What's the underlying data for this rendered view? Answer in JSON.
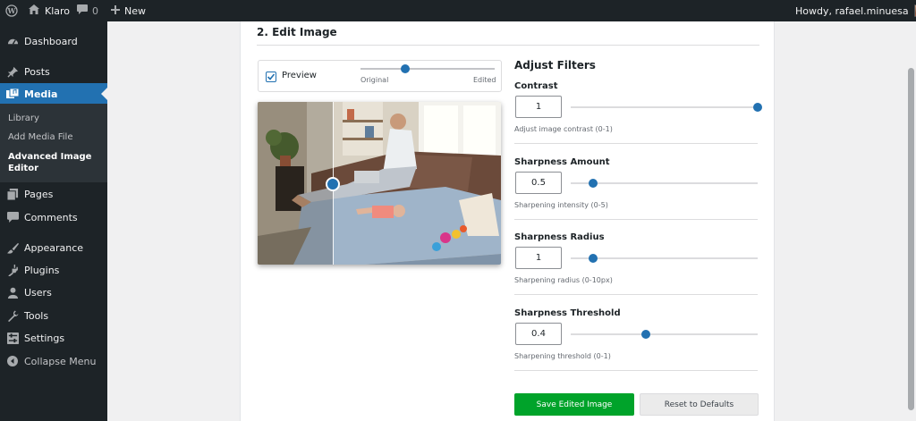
{
  "admin_bar": {
    "site_name": "Klaro",
    "comments_count": "0",
    "new_label": "New",
    "greeting": "Howdy, rafael.minuesa"
  },
  "sidebar": {
    "items": [
      {
        "label": "Dashboard",
        "icon": "dashboard-icon"
      },
      {
        "label": "Posts",
        "icon": "pin-icon"
      },
      {
        "label": "Media",
        "icon": "media-icon",
        "active": true
      },
      {
        "label": "Pages",
        "icon": "pages-icon"
      },
      {
        "label": "Comments",
        "icon": "comment-icon"
      },
      {
        "label": "Appearance",
        "icon": "brush-icon"
      },
      {
        "label": "Plugins",
        "icon": "plug-icon"
      },
      {
        "label": "Users",
        "icon": "user-icon"
      },
      {
        "label": "Tools",
        "icon": "wrench-icon"
      },
      {
        "label": "Settings",
        "icon": "settings-icon"
      },
      {
        "label": "Collapse Menu",
        "icon": "collapse-icon"
      }
    ],
    "submenu": [
      "Library",
      "Add Media File",
      "Advanced Image Editor"
    ]
  },
  "editor": {
    "section_title": "2. Edit Image",
    "preview_label": "Preview",
    "preview_checked": true,
    "compare_original": "Original",
    "compare_edited": "Edited",
    "compare_position": 0.33,
    "split_position": 0.31
  },
  "filters": {
    "title": "Adjust Filters",
    "items": [
      {
        "label": "Contrast",
        "value": "1",
        "help": "Adjust image contrast (0-1)",
        "fraction": 1.0
      },
      {
        "label": "Sharpness Amount",
        "value": "0.5",
        "help": "Sharpening intensity (0-5)",
        "fraction": 0.12
      },
      {
        "label": "Sharpness Radius",
        "value": "1",
        "help": "Sharpening radius (0-10px)",
        "fraction": 0.12
      },
      {
        "label": "Sharpness Threshold",
        "value": "0.4",
        "help": "Sharpening threshold (0-1)",
        "fraction": 0.4
      }
    ]
  },
  "actions": {
    "save": "Save Edited Image",
    "reset": "Reset to Defaults"
  },
  "colors": {
    "admin_dark": "#1d2327",
    "accent_blue": "#2271b1",
    "save_green": "#00a32a"
  }
}
